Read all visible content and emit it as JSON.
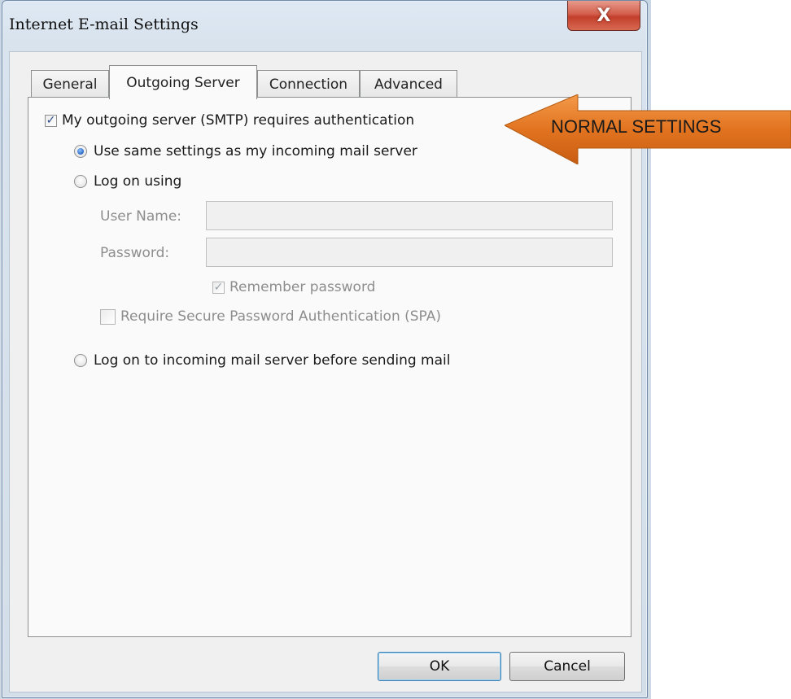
{
  "window": {
    "title": "Internet E-mail Settings",
    "close_glyph": "X"
  },
  "tabs": [
    {
      "label": "General",
      "active": false
    },
    {
      "label": "Outgoing Server",
      "active": true
    },
    {
      "label": "Connection",
      "active": false
    },
    {
      "label": "Advanced",
      "active": false
    }
  ],
  "outgoing": {
    "requires_auth": {
      "label": "My outgoing server (SMTP) requires authentication",
      "checked": true
    },
    "use_same": {
      "label": "Use same settings as my incoming mail server",
      "selected": true
    },
    "log_on_using": {
      "label": "Log on using",
      "selected": false
    },
    "user_name": {
      "label": "User Name:",
      "value": ""
    },
    "password": {
      "label": "Password:",
      "value": ""
    },
    "remember_password": {
      "label": "Remember password",
      "checked": true,
      "enabled": false
    },
    "spa": {
      "label": "Require Secure Password Authentication (SPA)",
      "checked": false,
      "enabled": false
    },
    "log_on_incoming": {
      "label": "Log on to incoming mail server before sending mail",
      "selected": false
    }
  },
  "footer": {
    "ok_label": "OK",
    "cancel_label": "Cancel"
  },
  "annotation": {
    "text": "NORMAL SETTINGS",
    "color": "#e2761e"
  },
  "icons": {
    "checkmark": "✓"
  }
}
